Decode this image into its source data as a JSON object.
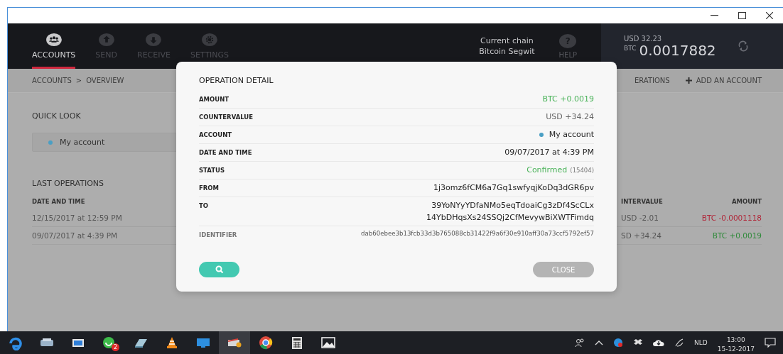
{
  "nav": [
    {
      "label": "ACCOUNTS",
      "selected": true
    },
    {
      "label": "SEND",
      "selected": false
    },
    {
      "label": "RECEIVE",
      "selected": false
    },
    {
      "label": "SETTINGS",
      "selected": false
    }
  ],
  "chain": {
    "label": "Current chain",
    "value": "Bitcoin Segwit"
  },
  "help": {
    "symbol": "?",
    "label": "HELP"
  },
  "balance": {
    "fiat": "USD 32.23",
    "unit": "BTC",
    "amount": "0.0017882"
  },
  "breadcrumb": {
    "items": [
      "ACCOUNTS",
      "OVERVIEW"
    ],
    "separator": ">"
  },
  "actions": [
    {
      "label": "ERATIONS",
      "kind": "link"
    },
    {
      "label": "ADD AN ACCOUNT",
      "kind": "add"
    }
  ],
  "quick_look": {
    "title": "QUICK LOOK",
    "accounts": [
      {
        "name": "My account",
        "color": "#4a9fc4"
      }
    ]
  },
  "last_operations": {
    "title": "LAST OPERATIONS",
    "columns": [
      "DATE AND TIME",
      "INTERVALUE",
      "AMOUNT"
    ],
    "rows": [
      {
        "date": "12/15/2017 at 12:59 PM",
        "countervalue": "USD -2.01",
        "amount": "BTC -0.0001118",
        "kind": "sent"
      },
      {
        "date": "09/07/2017 at 4:39 PM",
        "countervalue": "SD +34.24",
        "amount": "BTC +0.0019",
        "kind": "received"
      }
    ]
  },
  "dialog": {
    "title": "OPERATION DETAIL",
    "fields": [
      {
        "label": "AMOUNT",
        "kind": "positive",
        "value": "BTC +0.0019"
      },
      {
        "label": "COUNTERVALUE",
        "kind": "muted",
        "value": "USD +34.24"
      },
      {
        "label": "ACCOUNT",
        "kind": "account",
        "value": "My account",
        "color": "#4a9fc4"
      },
      {
        "label": "DATE AND TIME",
        "kind": "plain",
        "value": "09/07/2017 at 4:39 PM"
      },
      {
        "label": "STATUS",
        "kind": "status",
        "value": "Confirmed",
        "detail": "(15404)"
      },
      {
        "label": "FROM",
        "kind": "plain",
        "value": "1j3omz6fCM6a7Gq1swfyqjKoDq3dGR6pv"
      },
      {
        "label": "TO",
        "kind": "lines",
        "lines": [
          "39YoNYyYDfaNMo5eqTdoaiCg3zDf4ScCLx",
          "14YbDHqsXs24SSQj2CfMevywBiXWTFimdq"
        ]
      },
      {
        "label": "IDENTIFIER",
        "kind": "identifier",
        "value": "dab60ebee3b13fcb33d3b765088cb31422f9a6f30e910aff30a73ccf5792ef57"
      }
    ],
    "close_label": "CLOSE"
  },
  "taskbar": {
    "badge": "2",
    "language": "NLD",
    "time": "13:00",
    "date": "15-12-2017"
  }
}
